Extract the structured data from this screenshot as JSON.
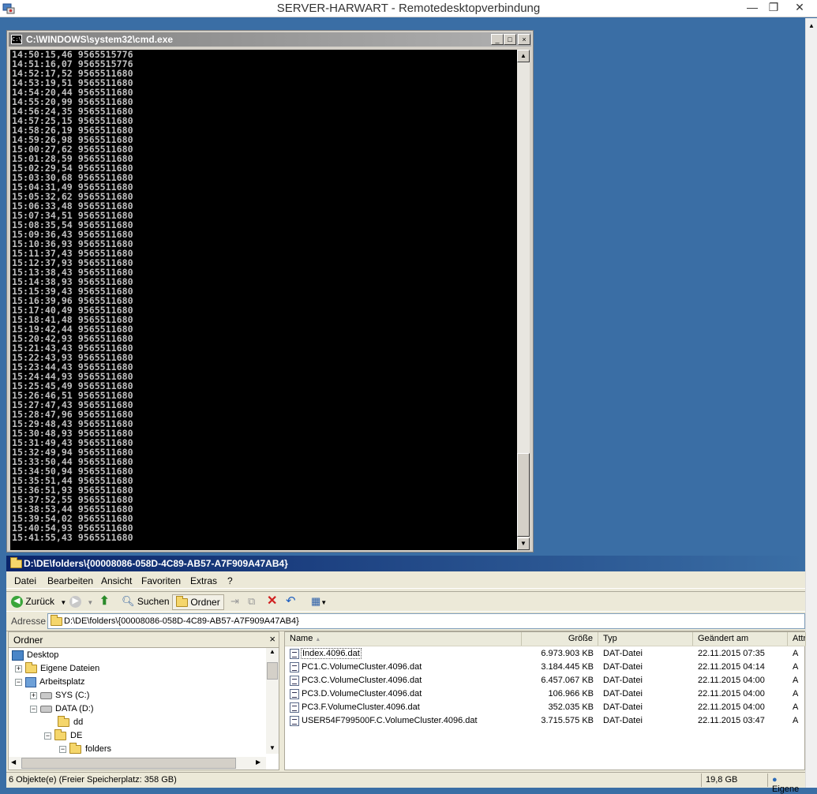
{
  "rdp": {
    "title": "SERVER-HARWART - Remotedesktopverbindung",
    "minimize": "—",
    "restore": "❐",
    "close": "✕"
  },
  "cmd": {
    "title": "C:\\WINDOWS\\system32\\cmd.exe",
    "icon_text": "C:\\",
    "lines": [
      "14:50:15,46 9565515776",
      "14:51:16,07 9565515776",
      "14:52:17,52 9565511680",
      "14:53:19,51 9565511680",
      "14:54:20,44 9565511680",
      "14:55:20,99 9565511680",
      "14:56:24,35 9565511680",
      "14:57:25,15 9565511680",
      "14:58:26,19 9565511680",
      "14:59:26,98 9565511680",
      "15:00:27,62 9565511680",
      "15:01:28,59 9565511680",
      "15:02:29,54 9565511680",
      "15:03:30,68 9565511680",
      "15:04:31,49 9565511680",
      "15:05:32,62 9565511680",
      "15:06:33,48 9565511680",
      "15:07:34,51 9565511680",
      "15:08:35,54 9565511680",
      "15:09:36,43 9565511680",
      "15:10:36,93 9565511680",
      "15:11:37,43 9565511680",
      "15:12:37,93 9565511680",
      "15:13:38,43 9565511680",
      "15:14:38,93 9565511680",
      "15:15:39,43 9565511680",
      "15:16:39,96 9565511680",
      "15:17:40,49 9565511680",
      "15:18:41,48 9565511680",
      "15:19:42,44 9565511680",
      "15:20:42,93 9565511680",
      "15:21:43,43 9565511680",
      "15:22:43,93 9565511680",
      "15:23:44,43 9565511680",
      "15:24:44,93 9565511680",
      "15:25:45,49 9565511680",
      "15:26:46,51 9565511680",
      "15:27:47,43 9565511680",
      "15:28:47,96 9565511680",
      "15:29:48,43 9565511680",
      "15:30:48,93 9565511680",
      "15:31:49,43 9565511680",
      "15:32:49,94 9565511680",
      "15:33:50,44 9565511680",
      "15:34:50,94 9565511680",
      "15:35:51,44 9565511680",
      "15:36:51,93 9565511680",
      "15:37:52,55 9565511680",
      "15:38:53,44 9565511680",
      "15:39:54,02 9565511680",
      "15:40:54,93 9565511680",
      "15:41:55,43 9565511680"
    ]
  },
  "explorer": {
    "title": "D:\\DE\\folders\\{00008086-058D-4C89-AB57-A7F909A47AB4}",
    "menu": [
      "Datei",
      "Bearbeiten",
      "Ansicht",
      "Favoriten",
      "Extras",
      "?"
    ],
    "toolbar": {
      "back": "Zurück",
      "search": "Suchen",
      "folders": "Ordner"
    },
    "address": {
      "label": "Adresse",
      "value": "D:\\DE\\folders\\{00008086-058D-4C89-AB57-A7F909A47AB4}"
    },
    "folder_pane": {
      "title": "Ordner",
      "close": "×",
      "tree": [
        {
          "label": "Desktop",
          "expander": ""
        },
        {
          "label": "Eigene Dateien",
          "expander": "+"
        },
        {
          "label": "Arbeitsplatz",
          "expander": "−"
        },
        {
          "label": "SYS (C:)",
          "expander": "+"
        },
        {
          "label": "DATA (D:)",
          "expander": "−"
        },
        {
          "label": "dd",
          "expander": ""
        },
        {
          "label": "DE",
          "expander": "−"
        },
        {
          "label": "folders",
          "expander": "−"
        }
      ]
    },
    "columns": [
      "Name",
      "Größe",
      "Typ",
      "Geändert am",
      "Attr"
    ],
    "files": [
      {
        "name": "Index.4096.dat",
        "size": "6.973.903 KB",
        "type": "DAT-Datei",
        "modified": "22.11.2015 07:35",
        "attr": "A"
      },
      {
        "name": "PC1.C.VolumeCluster.4096.dat",
        "size": "3.184.445 KB",
        "type": "DAT-Datei",
        "modified": "22.11.2015 04:14",
        "attr": "A"
      },
      {
        "name": "PC3.C.VolumeCluster.4096.dat",
        "size": "6.457.067 KB",
        "type": "DAT-Datei",
        "modified": "22.11.2015 04:00",
        "attr": "A"
      },
      {
        "name": "PC3.D.VolumeCluster.4096.dat",
        "size": "106.966 KB",
        "type": "DAT-Datei",
        "modified": "22.11.2015 04:00",
        "attr": "A"
      },
      {
        "name": "PC3.F.VolumeCluster.4096.dat",
        "size": "352.035 KB",
        "type": "DAT-Datei",
        "modified": "22.11.2015 04:00",
        "attr": "A"
      },
      {
        "name": "USER54F799500F.C.VolumeCluster.4096.dat",
        "size": "3.715.575 KB",
        "type": "DAT-Datei",
        "modified": "22.11.2015 03:47",
        "attr": "A"
      }
    ],
    "status": {
      "objects": "6 Objekte(e) (Freier Speicherplatz: 358 GB)",
      "size": "19,8 GB",
      "zone": "Eigene"
    }
  },
  "colors": {
    "desktop": "#3a6ea5",
    "console_bg": "#000000",
    "console_fg": "#c0c0c0",
    "explorer_title": "#0a246a"
  }
}
